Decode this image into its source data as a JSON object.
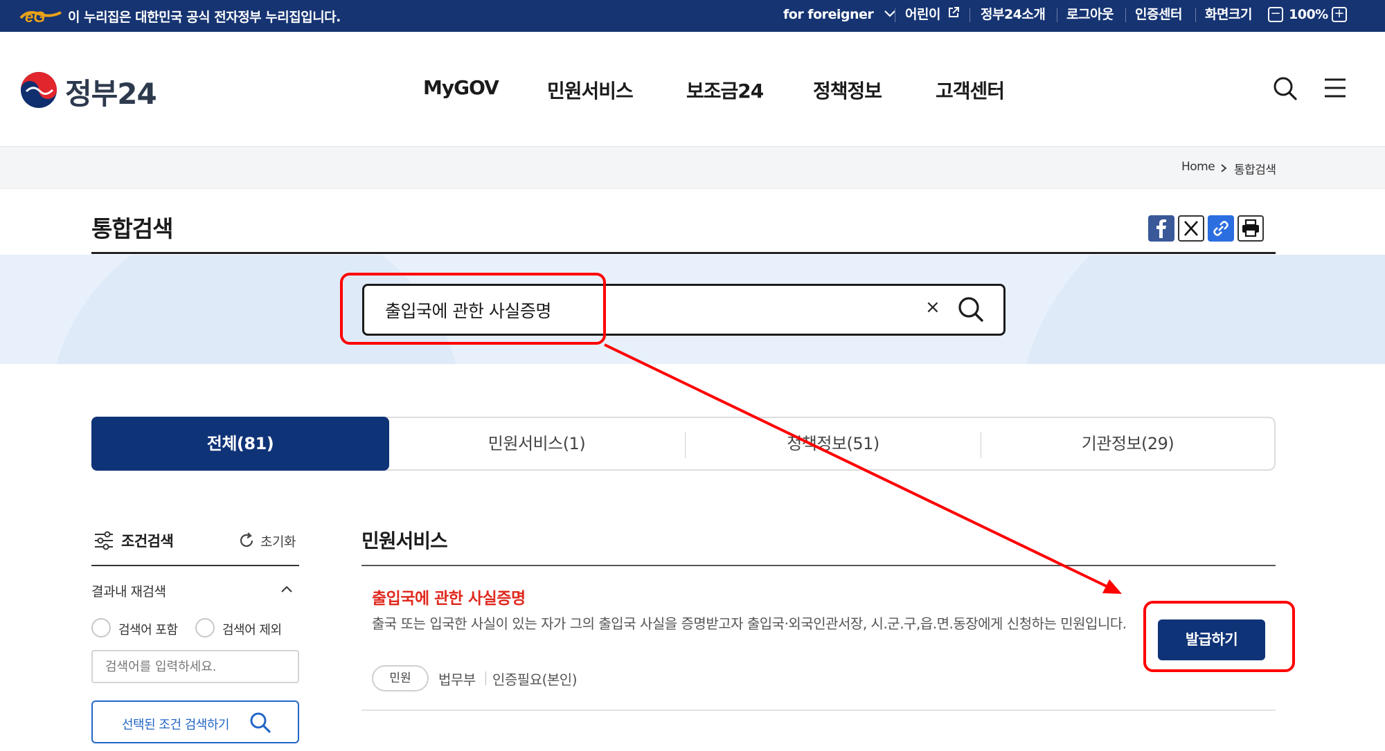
{
  "gov_banner": {
    "text": "이 누리집은 대한민국 공식 전자정부 누리집입니다.",
    "links": {
      "foreigner": "for foreigner",
      "kids": "어린이",
      "about": "정부24소개",
      "logout": "로그아웃",
      "cert": "인증센터",
      "screen_size": "화면크기",
      "zoom_minus": "−",
      "zoom_value": "100%",
      "zoom_plus": "+"
    }
  },
  "header": {
    "brand": "정부24",
    "nav": [
      "MyGOV",
      "민원서비스",
      "보조금24",
      "정책정보",
      "고객센터"
    ]
  },
  "breadcrumb": {
    "home": "Home",
    "current": "통합검색"
  },
  "page": {
    "title": "통합검색"
  },
  "search": {
    "query": "출입국에 관한 사실증명",
    "clear": "×"
  },
  "tabs": [
    {
      "label": "전체(81)",
      "active": true
    },
    {
      "label": "민원서비스(1)",
      "active": false
    },
    {
      "label": "정책정보(51)",
      "active": false
    },
    {
      "label": "기관정보(29)",
      "active": false
    }
  ],
  "filter": {
    "title": "조건검색",
    "reset": "초기화",
    "refine_label": "결과내 재검색",
    "include_label": "검색어 포함",
    "exclude_label": "검색어 제외",
    "input_placeholder": "검색어를 입력하세요.",
    "search_button": "선택된 조건 검색하기"
  },
  "results": {
    "section_title": "민원서비스",
    "item": {
      "title": "출입국에 관한 사실증명",
      "description": "출국 또는 입국한 사실이 있는 자가 그의 출입국 사실을 증명받고자 출입국·외국인관서장, 시.군.구,읍.면.동장에게 신청하는 민원입니다.",
      "tag": "민원",
      "agency": "법무부",
      "auth": "인증필요(본인)",
      "button": "발급하기"
    }
  },
  "colors": {
    "primary": "#0f3377",
    "gov_banner": "#163472",
    "highlight_red": "#ff0000",
    "result_title": "#e0281e",
    "band": "#e7f0fb"
  }
}
